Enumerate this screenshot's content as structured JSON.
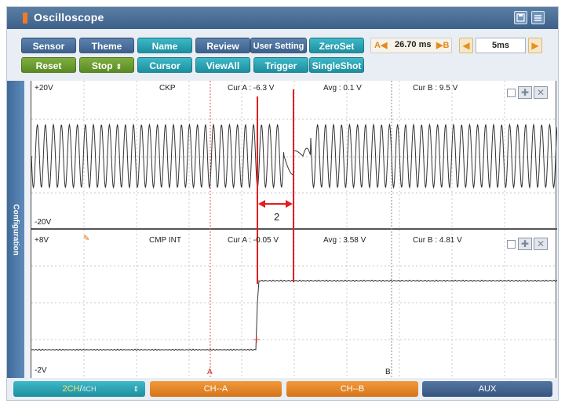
{
  "window": {
    "title": "Oscilloscope"
  },
  "toolbar": {
    "row1": [
      "Sensor",
      "Theme",
      "Name",
      "Review",
      "User Setting",
      "ZeroSet"
    ],
    "row2": [
      "Reset",
      "Stop",
      "Cursor",
      "ViewAll",
      "Trigger",
      "SingleShot"
    ],
    "cursor_time": {
      "a_marker": "A◀",
      "value": "26.70 ms",
      "b_marker": "▶B"
    },
    "timebase": "5ms"
  },
  "side_tab": "Configuration",
  "channel1": {
    "top_label": "+20V",
    "bottom_label": "-20V",
    "name": "CKP",
    "cur_a": "Cur A : -6.3 V",
    "avg": "Avg : 0.1 V",
    "cur_b": "Cur B : 9.5 V"
  },
  "channel2": {
    "top_label": "+8V",
    "bottom_label": "-2V",
    "name": "CMP INT",
    "cur_a": "Cur A : -0.05 V",
    "avg": "Avg : 3.58 V",
    "cur_b": "Cur B : 4.81 V"
  },
  "cursor_markers": {
    "a": "A",
    "b": "B"
  },
  "annotation": {
    "label": "2"
  },
  "bottom": {
    "channels": {
      "selected": "2CH",
      "separator": "/",
      "other": "4CH"
    },
    "ch_a": "CH--A",
    "ch_b": "CH--B",
    "aux": "AUX"
  },
  "colors": {
    "title_bar": "#3d6089",
    "teal": "#1c8f9f",
    "orange": "#d6741a",
    "annotation_red": "#e02020"
  }
}
